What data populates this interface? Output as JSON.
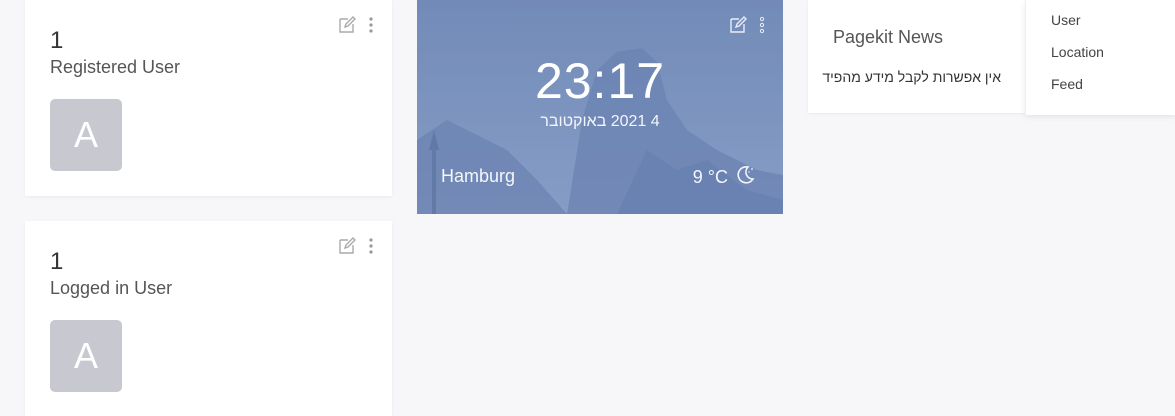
{
  "widgets": {
    "registered_user": {
      "count": "1",
      "label": "Registered User",
      "avatar_letter": "A"
    },
    "logged_in_user": {
      "count": "1",
      "label": "Logged in User",
      "avatar_letter": "A"
    },
    "clock": {
      "time": "23:17",
      "date": "4 2021 באוקטובר",
      "city": "Hamburg",
      "temperature": "9 °C",
      "weather_icon": "moon-icon"
    },
    "news": {
      "title": "Pagekit News",
      "message": "אין אפשרות לקבל מידע מהפיד"
    }
  },
  "dropdown": {
    "items": [
      "User",
      "Location",
      "Feed"
    ]
  },
  "icons": {
    "edit": "edit-icon",
    "more": "more-vertical-icon"
  }
}
